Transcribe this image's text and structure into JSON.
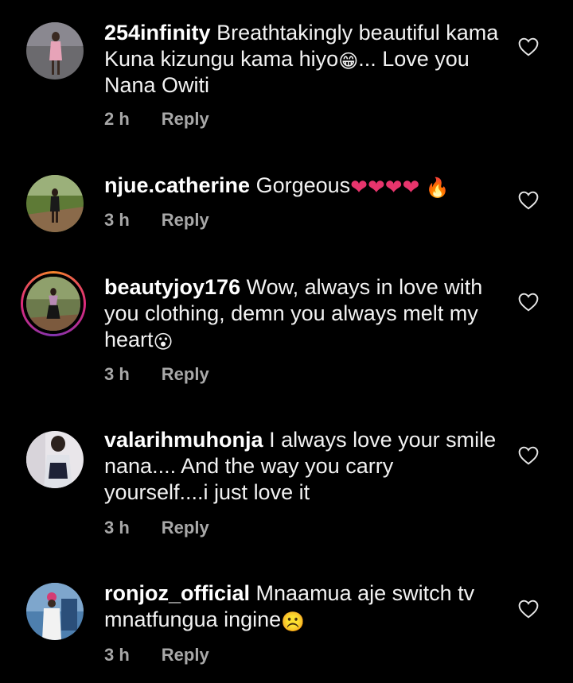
{
  "colors": {
    "background": "#000000",
    "text": "#f2f2f2",
    "meta": "#a8a8a8",
    "heart_emoji": "#e8356d"
  },
  "comments": [
    {
      "username": "254infinity",
      "text_parts": [
        "Breathtakingly beautiful kama Kuna kizungu kama hiyo",
        "😁",
        "... Love you Nana Owiti"
      ],
      "time": "2 h",
      "reply_label": "Reply",
      "like_icon": "heart-outline-icon"
    },
    {
      "username": "njue.catherine",
      "text_parts": [
        "Gorgeous",
        "❤❤❤❤",
        "🔥"
      ],
      "time": "3 h",
      "reply_label": "Reply",
      "like_icon": "heart-outline-icon"
    },
    {
      "username": "beautyjoy176",
      "text_parts": [
        "Wow, always in love with you clothing, demn you always melt my heart",
        "😮"
      ],
      "time": "3 h",
      "reply_label": "Reply",
      "like_icon": "heart-outline-icon"
    },
    {
      "username": "valarihmuhonja",
      "text_parts": [
        "I always love your smile nana.... And the way you carry yourself....i just love it"
      ],
      "time": "3 h",
      "reply_label": "Reply",
      "like_icon": "heart-outline-icon"
    },
    {
      "username": "ronjoz_official",
      "text_parts": [
        "Mnaamua aje  switch tv mnatfungua ingine",
        "☹️"
      ],
      "time": "3 h",
      "reply_label": "Reply",
      "like_icon": "heart-outline-icon"
    }
  ]
}
